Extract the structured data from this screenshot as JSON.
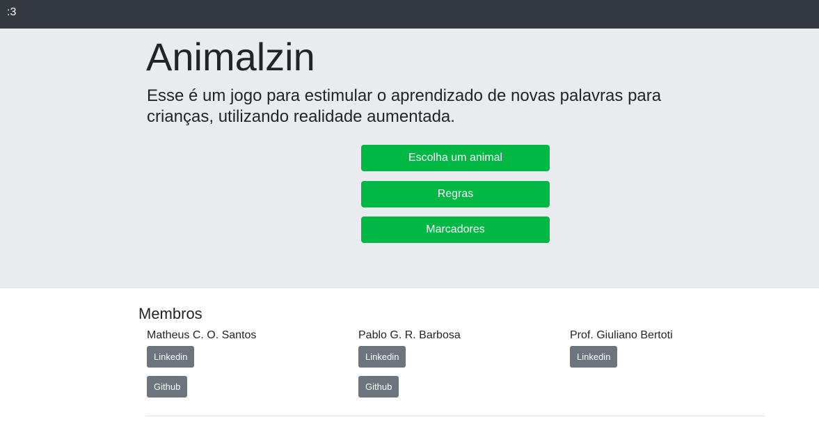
{
  "navbar": {
    "brand": ":3"
  },
  "hero": {
    "title": "Animalzin",
    "lead": "Esse é um jogo para estimular o aprendizado de novas palavras para crianças, utilizando realidade aumentada.",
    "buttons": [
      {
        "label": "Escolha um animal"
      },
      {
        "label": "Regras"
      },
      {
        "label": "Marcadores"
      }
    ],
    "button_color": "#00b843",
    "background": "#e9ecef"
  },
  "members": {
    "title": "Membros",
    "people": [
      {
        "name": "Matheus C. O. Santos",
        "linkedin_label": "Linkedin",
        "github_label": "Github"
      },
      {
        "name": "Pablo G. R. Barbosa",
        "linkedin_label": "Linkedin",
        "github_label": "Github"
      },
      {
        "name": "Prof. Giuliano Bertoti",
        "linkedin_label": "Linkedin"
      }
    ],
    "button_color": "#6c757d"
  }
}
